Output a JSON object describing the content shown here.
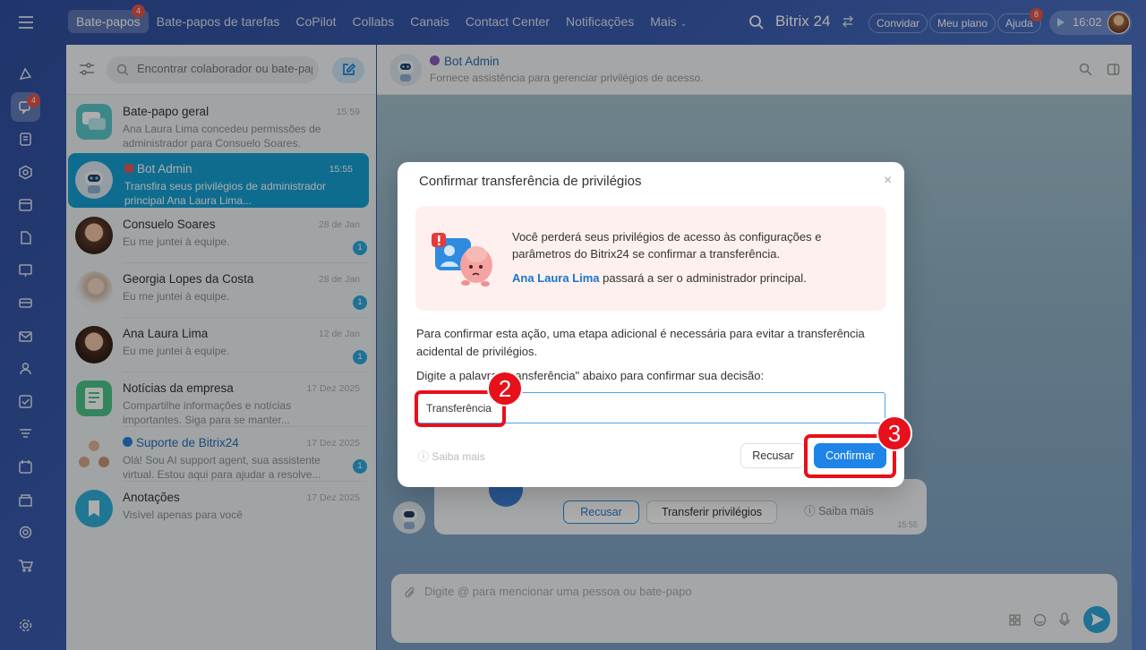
{
  "topbar": {
    "nav": [
      {
        "label": "Bate-papos",
        "badge": "4",
        "active": true
      },
      {
        "label": "Bate-papos de tarefas"
      },
      {
        "label": "CoPilot"
      },
      {
        "label": "Collabs"
      },
      {
        "label": "Canais"
      },
      {
        "label": "Contact Center"
      },
      {
        "label": "Notificações"
      },
      {
        "label": "Mais"
      }
    ],
    "brand": "Bitrix 24",
    "buttons": {
      "convidar": "Convidar",
      "meu_plano": "Meu plano",
      "ajuda": "Ajuda",
      "ajuda_badge": "8"
    },
    "time": "16:02"
  },
  "rail": {
    "chat_badge": "4"
  },
  "chatlist": {
    "search_placeholder": "Encontrar colaborador ou bate-papo",
    "items": [
      {
        "name": "Bate-papo geral",
        "date": "15:59",
        "message": "Ana Laura Lima concedeu permissões de administrador para Consuelo Soares."
      },
      {
        "name": "Bot Admin",
        "date": "15:55",
        "message": "Transfira seus privilégios de administrador principal Ana Laura Lima..."
      },
      {
        "name": "Consuelo Soares",
        "date": "28 de Jan",
        "message": "Eu me juntei à equipe.",
        "unread": "1"
      },
      {
        "name": "Georgia Lopes da Costa",
        "date": "28 de Jan",
        "message": "Eu me juntei à equipe.",
        "unread": "1"
      },
      {
        "name": "Ana Laura Lima",
        "date": "12 de Jan",
        "message": "Eu me juntei à equipe.",
        "unread": "1"
      },
      {
        "name": "Notícias da empresa",
        "date": "17 Dez 2025",
        "message": "Compartilhe informações e notícias importantes. Siga para se manter..."
      },
      {
        "name": "Suporte de Bitrix24",
        "date": "17 Dez 2025",
        "message": "Olá! Sou AI support agent, sua assistente virtual. Estou aqui para ajudar a resolve...",
        "unread": "1"
      },
      {
        "name": "Anotações",
        "date": "17 Dez 2025",
        "message": "Visível apenas para você"
      }
    ]
  },
  "chat": {
    "title": "Bot Admin",
    "subtitle": "Fornece assistência para gerenciar privilégios de acesso.",
    "card": {
      "recusar": "Recusar",
      "transferir": "Transferir privilégios",
      "saiba": "Saiba mais",
      "time": "15:55"
    },
    "input_placeholder": "Digite @ para mencionar uma pessoa ou bate-papo"
  },
  "modal": {
    "title": "Confirmar transferência de privilégios",
    "warning": "Você perderá seus privilégios de acesso às configurações e parâmetros do Bitrix24 se confirmar a transferência.",
    "warning_name": "Ana Laura Lima",
    "warning_suffix": "passará a ser o administrador principal.",
    "text1": "Para confirmar esta ação, uma etapa adicional é necessária para evitar a transferência acidental de privilégios.",
    "text2": "Digite a palavra \"Transferência\" abaixo para confirmar sua decisão:",
    "input_value": "Transferência",
    "saiba": "Saiba mais",
    "recusar": "Recusar",
    "confirmar": "Confirmar"
  },
  "annotations": {
    "step2": "2",
    "step3": "3"
  },
  "colors": {
    "accent": "#1e84e8",
    "selected_row": "#16a0d3",
    "highlight": "#e8101a"
  }
}
